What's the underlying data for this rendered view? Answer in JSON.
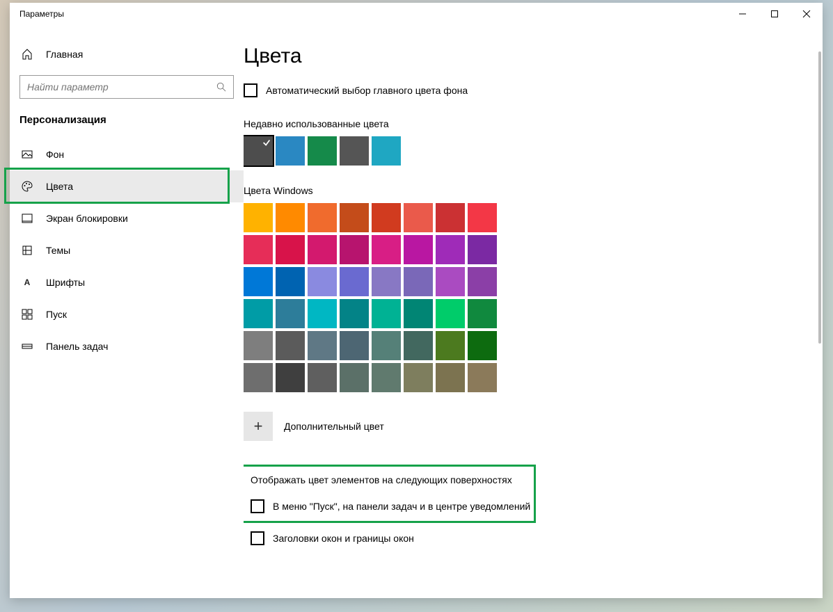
{
  "titlebar": {
    "title": "Параметры"
  },
  "sidebar": {
    "home": "Главная",
    "search_placeholder": "Найти параметр",
    "category": "Персонализация",
    "items": [
      {
        "label": "Фон"
      },
      {
        "label": "Цвета"
      },
      {
        "label": "Экран блокировки"
      },
      {
        "label": "Темы"
      },
      {
        "label": "Шрифты"
      },
      {
        "label": "Пуск"
      },
      {
        "label": "Панель задач"
      }
    ]
  },
  "content": {
    "title": "Цвета",
    "auto_pick": "Автоматический выбор главного цвета фона",
    "recent_heading": "Недавно использованные цвета",
    "recent_colors": [
      "#4d4d4d",
      "#2a88c2",
      "#158a4a",
      "#555555",
      "#1fa7c2"
    ],
    "recent_selected_index": 0,
    "windows_colors_heading": "Цвета Windows",
    "windows_colors": [
      "#ffb200",
      "#ff8a00",
      "#f06b2d",
      "#c44c1a",
      "#d13b1f",
      "#ea5a4b",
      "#cb3133",
      "#f33746",
      "#e62d58",
      "#d8134a",
      "#d3196e",
      "#b7146e",
      "#d81e85",
      "#b917a2",
      "#9f2bb8",
      "#7b29a3",
      "#0078d7",
      "#0063b1",
      "#8a8ae0",
      "#6a6ad0",
      "#8878c4",
      "#7a68b8",
      "#aa4bc1",
      "#8b3fa7",
      "#009ca6",
      "#2d7d9a",
      "#00b7c3",
      "#038387",
      "#00b294",
      "#018574",
      "#00cc6a",
      "#10893e",
      "#7e7e7e",
      "#5b5b5b",
      "#5f7885",
      "#4d6673",
      "#558078",
      "#42685f",
      "#4c7a1f",
      "#0d6b0f",
      "#6e6e6e",
      "#3f3f3f",
      "#5f5f5f",
      "#5b7068",
      "#607a6e",
      "#7e7e5e",
      "#7c7350",
      "#8b7a5a"
    ],
    "add_color_label": "Дополнительный цвет",
    "surfaces_heading": "Отображать цвет элементов на следующих поверхностях",
    "surfaces_checks": [
      "В меню \"Пуск\", на панели задач и в центре уведомлений",
      "Заголовки окон и границы окон"
    ]
  }
}
